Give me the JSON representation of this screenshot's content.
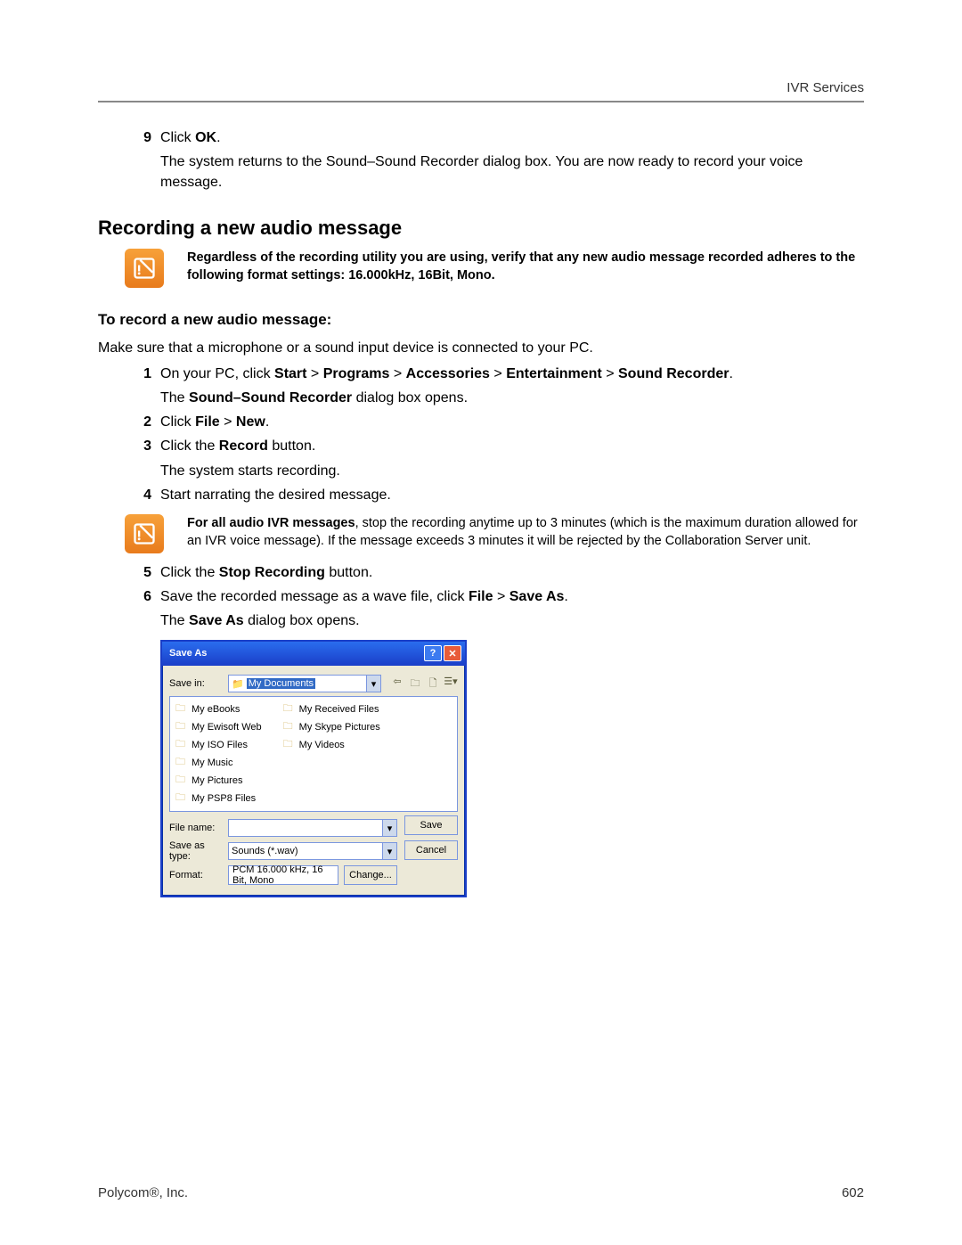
{
  "header": {
    "right": "IVR Services"
  },
  "step9": {
    "num": "9",
    "prefix": "Click ",
    "bold": "OK",
    "suffix": "."
  },
  "step9_follow": "The system returns to the Sound–Sound Recorder dialog box. You are now ready to record your voice message.",
  "section_title": "Recording a new audio message",
  "note1": "Regardless of the recording utility you are using, verify that any new audio message recorded adheres to the following format settings: 16.000kHz, 16Bit, Mono.",
  "sub_title": "To record a new audio message:",
  "intro": "Make sure that a microphone or a sound input device is connected to your PC.",
  "steps": {
    "s1": {
      "num": "1",
      "a": "On your PC, click ",
      "b": "Start",
      "c": " > ",
      "d": "Programs",
      "e": " > ",
      "f": "Accessories",
      "g": " > ",
      "h": "Entertainment",
      "i": " > ",
      "j": "Sound Recorder",
      "k": "."
    },
    "s1_follow_a": "The ",
    "s1_follow_b": "Sound–Sound Recorder",
    "s1_follow_c": " dialog box opens.",
    "s2": {
      "num": "2",
      "a": "Click ",
      "b": "File",
      "c": " > ",
      "d": "New",
      "e": "."
    },
    "s3": {
      "num": "3",
      "a": "Click the ",
      "b": "Record",
      "c": " button."
    },
    "s3_follow": "The system starts recording.",
    "s4": {
      "num": "4",
      "a": "Start narrating the desired message."
    }
  },
  "note2_a": "For all audio IVR messages",
  "note2_b": ", stop the recording anytime up to 3 minutes (which is the maximum duration allowed for an IVR voice message). If the message exceeds 3 minutes it will be rejected by the Collaboration Server unit.",
  "steps2": {
    "s5": {
      "num": "5",
      "a": "Click the ",
      "b": "Stop Recording",
      "c": " button."
    },
    "s6": {
      "num": "6",
      "a": "Save the recorded message as a wave file, click ",
      "b": "File",
      "c": " > ",
      "d": "Save As",
      "e": "."
    },
    "s6_follow_a": "The ",
    "s6_follow_b": "Save As",
    "s6_follow_c": " dialog box opens."
  },
  "dialog": {
    "title": "Save As",
    "savein_label": "Save in:",
    "savein_value": "My Documents",
    "files": [
      "My eBooks",
      "My Ewisoft Web",
      "My ISO Files",
      "My Music",
      "My Pictures",
      "My PSP8 Files",
      "My Received Files",
      "My Skype Pictures",
      "My Videos"
    ],
    "filename_label": "File name:",
    "filename_value": "",
    "savetype_label": "Save as type:",
    "savetype_value": "Sounds (*.wav)",
    "format_label": "Format:",
    "format_value": "PCM 16.000 kHz, 16 Bit, Mono",
    "btn_save": "Save",
    "btn_cancel": "Cancel",
    "btn_change": "Change..."
  },
  "footer": {
    "left": "Polycom®, Inc.",
    "right": "602"
  }
}
